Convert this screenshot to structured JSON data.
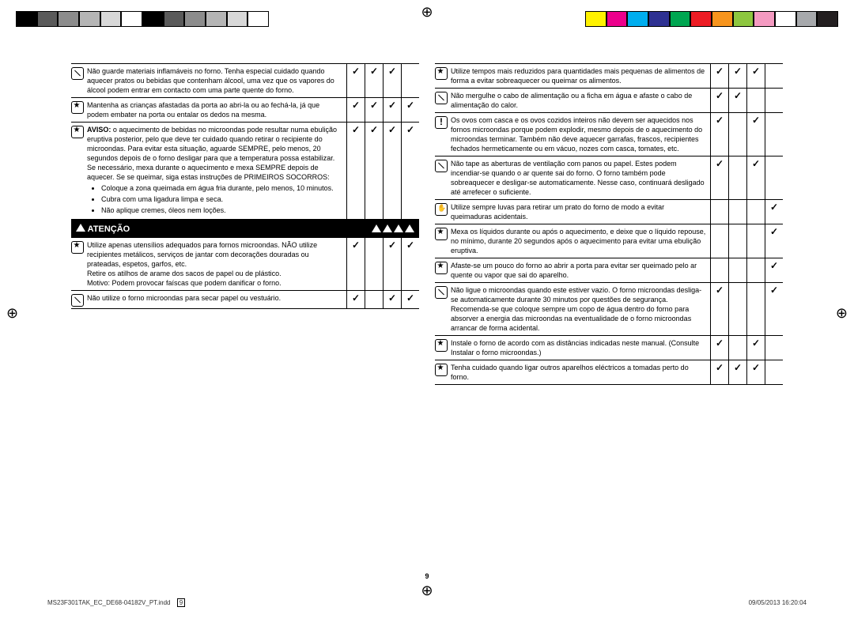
{
  "colors_left": [
    "#000000",
    "#5a5a5a",
    "#8c8c8c",
    "#b5b5b5",
    "#d8d8d8",
    "#ffffff",
    "#000000",
    "#5a5a5a",
    "#8c8c8c",
    "#b5b5b5",
    "#d8d8d8",
    "#ffffff"
  ],
  "colors_right": [
    "#fff200",
    "#ec008c",
    "#00aeef",
    "#2e3192",
    "#00a651",
    "#ed1c24",
    "#f7941d",
    "#8dc63f",
    "#f49ac1",
    "#ffffff",
    "#a7a9ac",
    "#231f20"
  ],
  "left_col": {
    "rows_a": [
      {
        "icon": "ban",
        "text": "Não guarde materiais inflamáveis no forno. Tenha especial cuidado quando aquecer pratos ou bebidas que contenham álcool, uma vez que os vapores do álcool podem entrar em contacto com uma parte quente do forno.",
        "checks": [
          true,
          true,
          true,
          false
        ]
      },
      {
        "icon": "star",
        "text": "Mantenha as crianças afastadas da porta ao abri-la ou ao fechá-la, já que podem embater na porta ou entalar os dedos na mesma.",
        "checks": [
          true,
          true,
          true,
          true
        ]
      },
      {
        "icon": "star",
        "text_html": "warning_bev",
        "bullets": [
          "Coloque a zona queimada em água fria durante, pelo menos, 10 minutos.",
          "Cubra com uma ligadura limpa e seca.",
          "Não aplique cremes, óleos nem loções."
        ],
        "checks": [
          true,
          true,
          true,
          true
        ]
      }
    ],
    "atencao_label": "ATENÇÃO",
    "rows_b": [
      {
        "icon": "star",
        "text": "Utilize apenas utensílios adequados para fornos microondas. NÃO utilize recipientes metálicos, serviços de jantar com decorações douradas ou prateadas, espetos, garfos, etc.\nRetire os atilhos de arame dos sacos de papel ou de plástico.\nMotivo: Podem provocar faíscas que podem danificar o forno.",
        "checks": [
          true,
          false,
          true,
          true
        ]
      },
      {
        "icon": "ban",
        "text": "Não utilize o forno microondas para secar papel ou vestuário.",
        "checks": [
          true,
          false,
          true,
          true
        ]
      }
    ]
  },
  "right_col": {
    "rows": [
      {
        "icon": "star",
        "text": "Utilize tempos mais reduzidos para quantidades mais pequenas de alimentos de forma a evitar sobreaquecer ou queimar os alimentos.",
        "checks": [
          true,
          true,
          true,
          false
        ]
      },
      {
        "icon": "ban",
        "text": "Não mergulhe o cabo de alimentação ou a ficha em água e afaste o cabo de alimentação do calor.",
        "checks": [
          true,
          true,
          false,
          false
        ]
      },
      {
        "icon": "excl",
        "text": "Os ovos com casca e os ovos cozidos inteiros não devem ser aquecidos nos fornos microondas porque podem explodir, mesmo depois de o aquecimento do microondas terminar. Também não deve aquecer garrafas, frascos, recipientes fechados hermeticamente ou em vácuo, nozes com casca, tomates, etc.",
        "checks": [
          true,
          false,
          true,
          false
        ]
      },
      {
        "icon": "ban",
        "text": "Não tape as aberturas de ventilação com panos ou papel. Estes podem incendiar-se quando o ar quente sai do forno. O forno também pode sobreaquecer e desligar-se automaticamente. Nesse caso, continuará desligado até arrefecer o suficiente.",
        "checks": [
          true,
          false,
          true,
          false
        ]
      },
      {
        "icon": "glove",
        "text": "Utilize sempre luvas para retirar um prato do forno de modo a evitar queimaduras acidentais.",
        "checks": [
          false,
          false,
          false,
          true
        ]
      },
      {
        "icon": "star",
        "text": "Mexa os líquidos durante ou após o aquecimento, e deixe que o líquido repouse, no mínimo, durante 20 segundos após o aquecimento para evitar uma ebulição eruptiva.",
        "checks": [
          false,
          false,
          false,
          true
        ]
      },
      {
        "icon": "star",
        "text": "Afaste-se um pouco do forno ao abrir a porta para evitar ser queimado pelo ar quente ou vapor que sai do aparelho.",
        "checks": [
          false,
          false,
          false,
          true
        ]
      },
      {
        "icon": "ban",
        "text": "Não ligue o microondas quando este estiver vazio. O forno microondas desliga-se automaticamente durante 30 minutos por questões de segurança. Recomenda-se que coloque sempre um copo de água dentro do forno para absorver a energia das microondas na eventualidade de o forno microondas arrancar de forma acidental.",
        "checks": [
          true,
          false,
          false,
          true
        ]
      },
      {
        "icon": "star",
        "text": "Instale o forno de acordo com as distâncias indicadas neste manual. (Consulte Instalar o forno microondas.)",
        "checks": [
          true,
          false,
          true,
          false
        ]
      },
      {
        "icon": "star",
        "text": "Tenha cuidado quando ligar outros aparelhos eléctricos a tomadas perto do forno.",
        "checks": [
          true,
          true,
          true,
          false
        ]
      }
    ]
  },
  "warning_bev_label": "AVISO:",
  "warning_bev_text": " o aquecimento de bebidas no microondas pode resultar numa ebulição eruptiva posterior, pelo que deve ter cuidado quando retirar o recipiente do microondas. Para evitar esta situação, aguarde SEMPRE, pelo menos, 20 segundos depois de o forno desligar para que a temperatura possa estabilizar. Se necessário, mexa durante o aquecimento e mexa SEMPRE depois de aquecer.\nSe se queimar, siga estas instruções de PRIMEIROS SOCORROS:",
  "page_number": "9",
  "footer_file": "MS23F301TAK_EC_DE68-04182V_PT.indd",
  "footer_pagenum": "9",
  "footer_date": "09/05/2013   16:20:04"
}
